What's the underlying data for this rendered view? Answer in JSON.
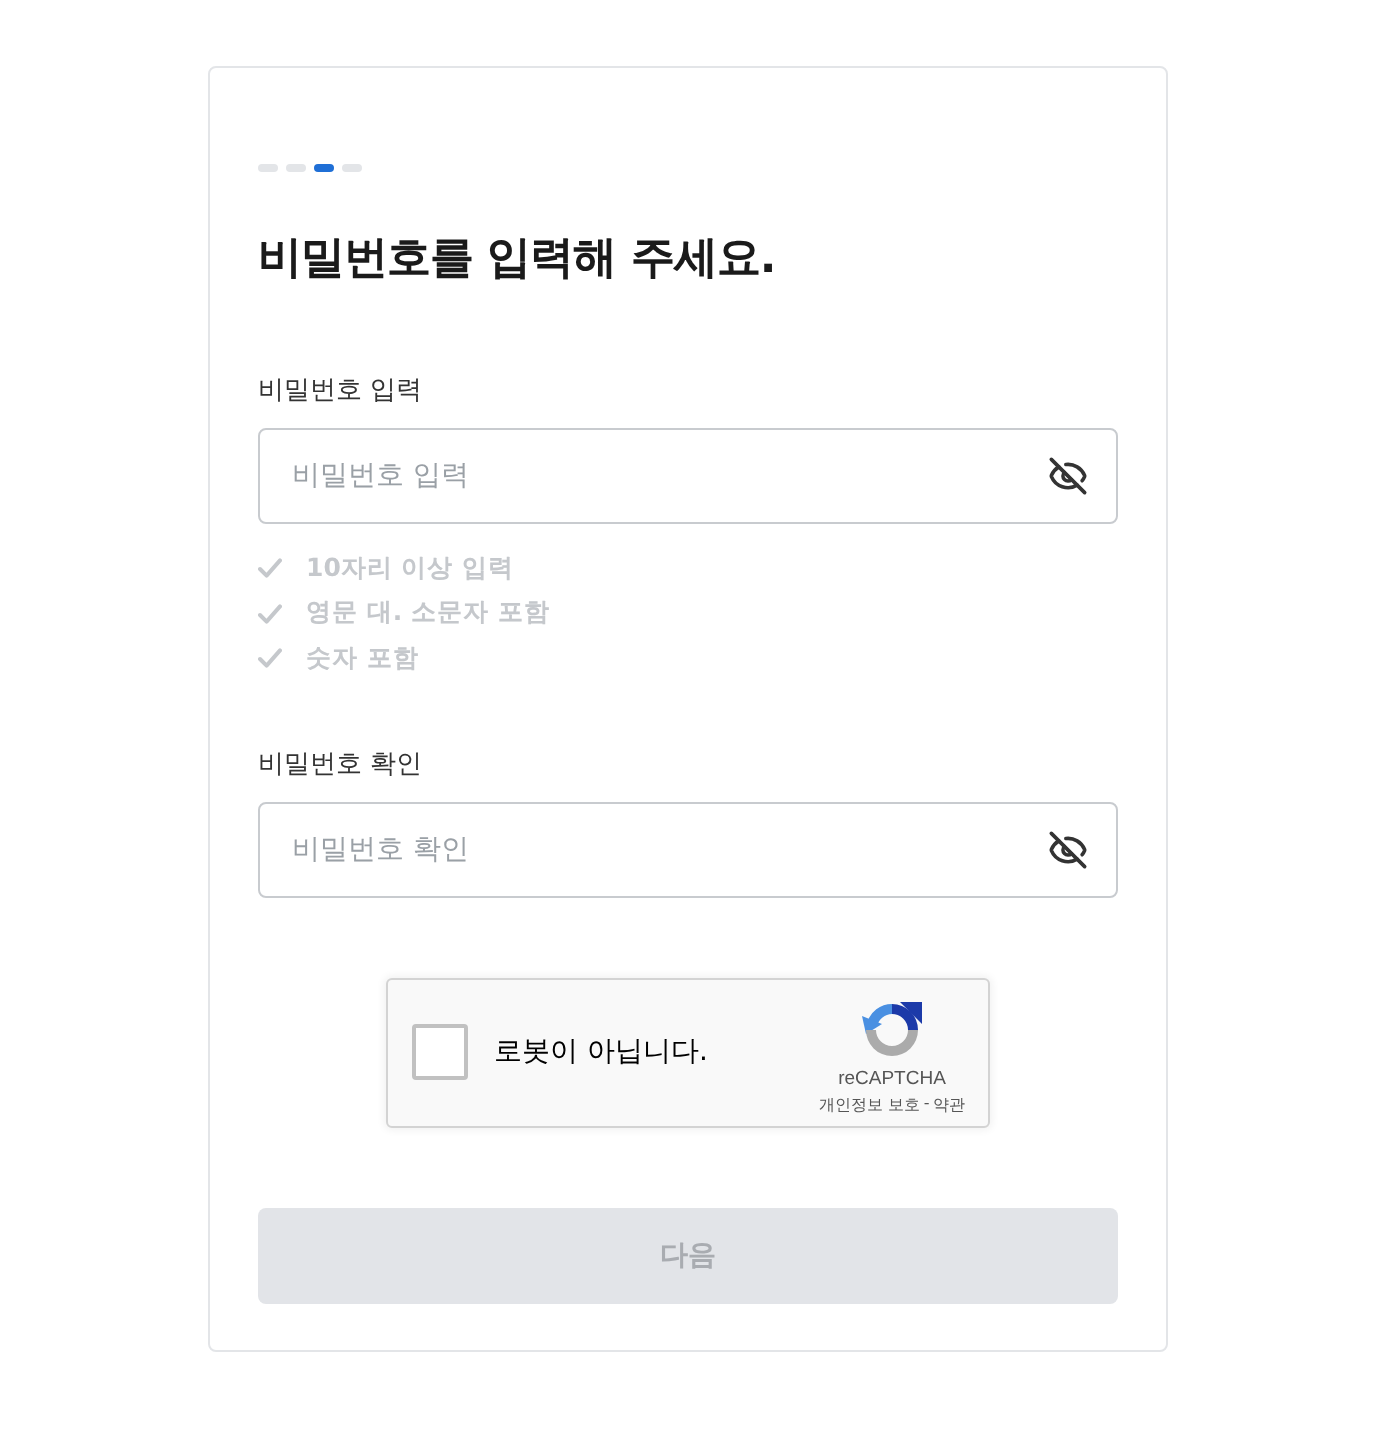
{
  "progress_steps": [
    {
      "selected": false
    },
    {
      "selected": false
    },
    {
      "selected": true
    },
    {
      "selected": false
    }
  ],
  "title": "비밀번호를 입력해 주세요.",
  "password_field": {
    "label": "비밀번호 입력",
    "placeholder": "비밀번호 입력",
    "visible": false
  },
  "rules": [
    {
      "text": "10자리 이상 입력",
      "met": false
    },
    {
      "text": "영문 대. 소문자 포함",
      "met": false
    },
    {
      "text": "숫자 포함",
      "met": false
    }
  ],
  "confirm_field": {
    "label": "비밀번호 확인",
    "placeholder": "비밀번호 확인",
    "visible": false
  },
  "captcha": {
    "label": "로봇이 아닙니다.",
    "checked": false,
    "brand": "reCAPTCHA",
    "privacy_link": "개인정보 보호",
    "separator": "-",
    "terms_link": "약관"
  },
  "next_button": {
    "label": "다음",
    "disabled": true
  }
}
